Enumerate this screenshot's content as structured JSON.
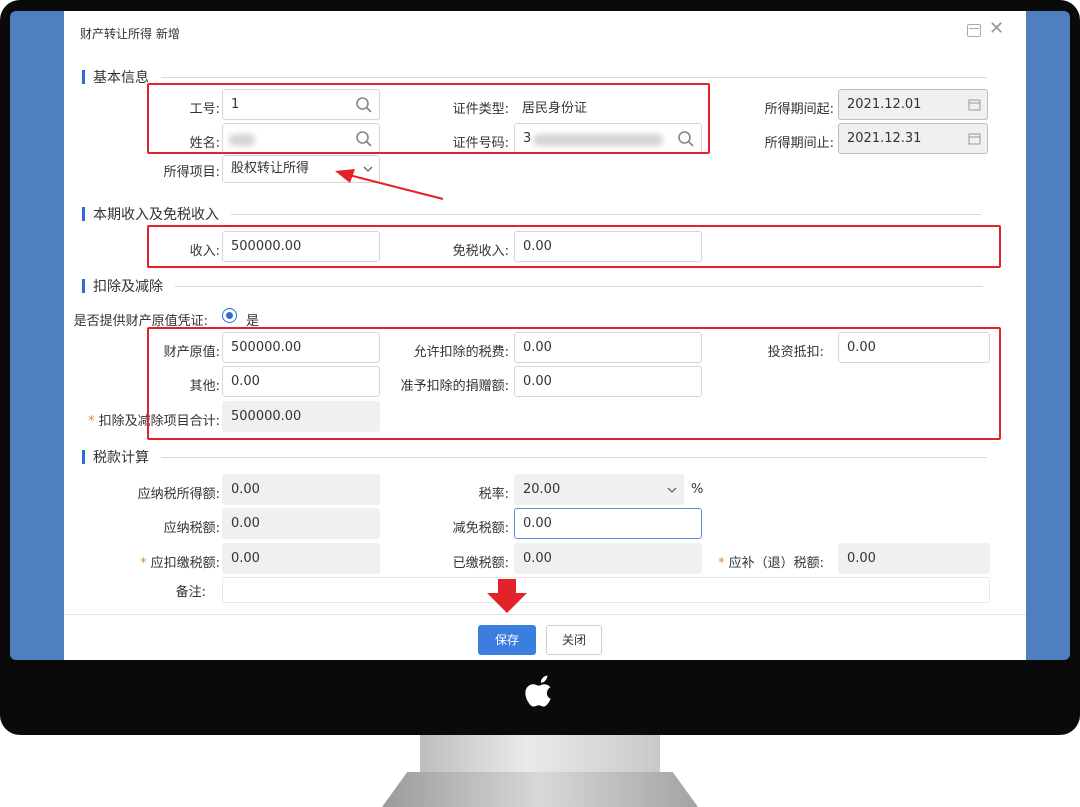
{
  "dialog": {
    "title": "财产转让所得 新增",
    "save_label": "保存",
    "close_label": "关闭"
  },
  "sections": {
    "basic": "基本信息",
    "income": "本期收入及免税收入",
    "deduction": "扣除及减除",
    "tax": "税款计算"
  },
  "basic": {
    "emp_no_label": "工号:",
    "emp_no_value": "1",
    "name_label": "姓名:",
    "name_value": "",
    "id_type_label": "证件类型:",
    "id_type_value": "居民身份证",
    "id_no_label": "证件号码:",
    "id_no_value": "3",
    "period_start_label": "所得期间起:",
    "period_start_value": "2021.12.01",
    "period_end_label": "所得期间止:",
    "period_end_value": "2021.12.31",
    "income_item_label": "所得项目:",
    "income_item_value": "股权转让所得"
  },
  "income": {
    "income_label": "收入:",
    "income_value": "500000.00",
    "exempt_label": "免税收入:",
    "exempt_value": "0.00"
  },
  "deduction": {
    "provide_label": "是否提供财产原值凭证:",
    "provide_value": "是",
    "original_value_label": "财产原值:",
    "original_value": "500000.00",
    "allowed_tax_label": "允许扣除的税费:",
    "allowed_tax_value": "0.00",
    "investment_label": "投资抵扣:",
    "investment_value": "0.00",
    "other_label": "其他:",
    "other_value": "0.00",
    "donation_label": "准予扣除的捐赠额:",
    "donation_value": "0.00",
    "total_label": "扣除及减除项目合计:",
    "total_value": "500000.00"
  },
  "tax": {
    "taxable_income_label": "应纳税所得额:",
    "taxable_income_value": "0.00",
    "rate_label": "税率:",
    "rate_value": "20.00",
    "rate_unit": "%",
    "tax_payable_label": "应纳税额:",
    "tax_payable_value": "0.00",
    "reduction_label": "减免税额:",
    "reduction_value": "0.00",
    "withhold_label": "应扣缴税额:",
    "withhold_value": "0.00",
    "paid_label": "已缴税额:",
    "paid_value": "0.00",
    "refund_label": "应补（退）税额:",
    "refund_value": "0.00",
    "remark_label": "备注:"
  },
  "colors": {
    "accent": "#3b7ee0",
    "annotation": "#e3232a",
    "monitor_frame": "#0a0a0a",
    "desktop": "#4f7fbe"
  },
  "icons": [
    "search-icon",
    "calendar-icon",
    "chevron-down-icon",
    "maximize-icon",
    "close-icon",
    "apple-logo"
  ]
}
